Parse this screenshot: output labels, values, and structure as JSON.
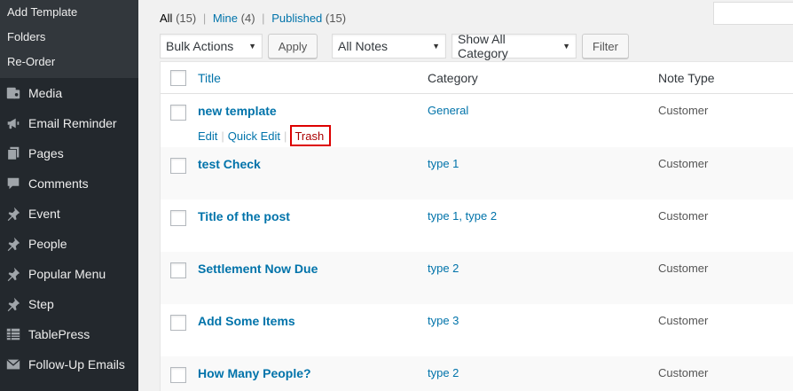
{
  "sidebar": {
    "submenu": [
      {
        "label": "Add Template"
      },
      {
        "label": "Folders"
      },
      {
        "label": "Re-Order"
      }
    ],
    "items": [
      {
        "label": "Media",
        "icon": "media-icon"
      },
      {
        "label": "Email Reminder",
        "icon": "megaphone-icon"
      },
      {
        "label": "Pages",
        "icon": "pages-icon"
      },
      {
        "label": "Comments",
        "icon": "comment-icon"
      },
      {
        "label": "Event",
        "icon": "pin-icon"
      },
      {
        "label": "People",
        "icon": "pin-icon"
      },
      {
        "label": "Popular Menu",
        "icon": "pin-icon"
      },
      {
        "label": "Step",
        "icon": "pin-icon"
      },
      {
        "label": "TablePress",
        "icon": "table-icon"
      },
      {
        "label": "Follow-Up Emails",
        "icon": "email-icon"
      }
    ]
  },
  "filters": {
    "all_label": "All",
    "all_count": "(15)",
    "mine_label": "Mine",
    "mine_count": "(4)",
    "published_label": "Published",
    "published_count": "(15)",
    "separator": "|"
  },
  "toolbar": {
    "bulk_actions": "Bulk Actions",
    "apply": "Apply",
    "all_notes": "All Notes",
    "all_category": "Show All Category",
    "filter": "Filter"
  },
  "table": {
    "columns": {
      "title": "Title",
      "category": "Category",
      "note_type": "Note Type"
    },
    "row_actions": {
      "edit": "Edit",
      "quick_edit": "Quick Edit",
      "trash": "Trash",
      "separator": "|"
    },
    "rows": [
      {
        "title": "new template",
        "category": "General",
        "note_type": "Customer"
      },
      {
        "title": "test Check",
        "category": "type 1",
        "note_type": "Customer"
      },
      {
        "title": "Title of the post",
        "category": "type 1, type 2",
        "note_type": "Customer"
      },
      {
        "title": "Settlement Now Due",
        "category": "type 2",
        "note_type": "Customer"
      },
      {
        "title": "Add Some Items",
        "category": "type 3",
        "note_type": "Customer"
      },
      {
        "title": "How Many People?",
        "category": "type 2",
        "note_type": "Customer"
      }
    ]
  },
  "colors": {
    "link": "#0073aa",
    "sidebar_bg": "#23282d",
    "highlight": "#dd0000"
  }
}
